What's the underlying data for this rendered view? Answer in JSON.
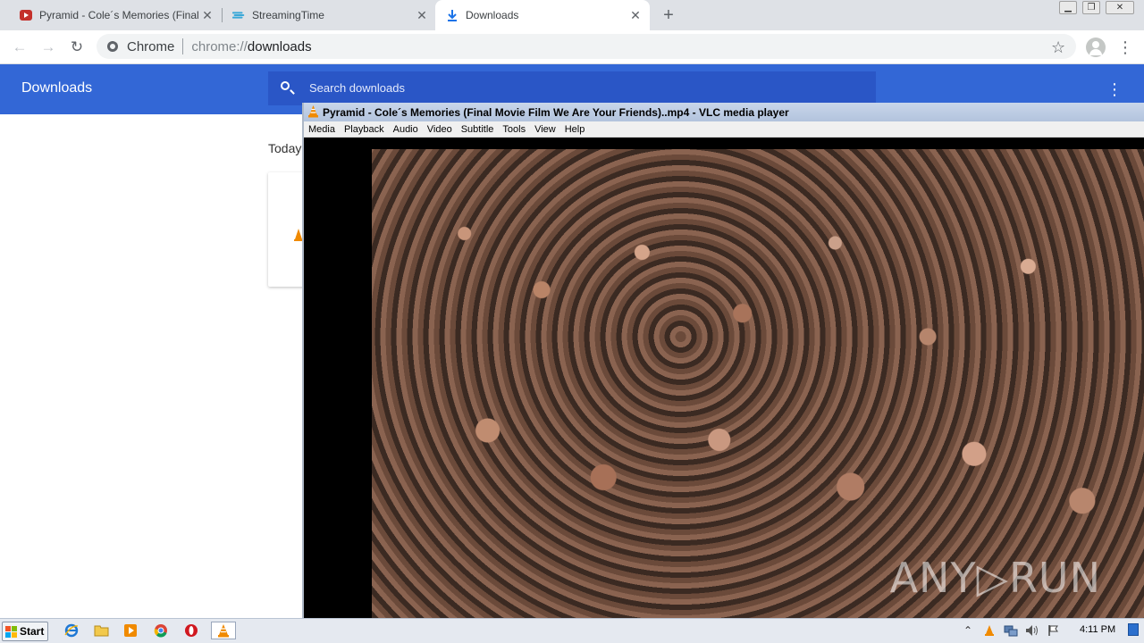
{
  "browser": {
    "tabs": [
      {
        "title": "Pyramid - Cole´s Memories (Final Mo",
        "favicon": "video-play-icon",
        "close": "✕",
        "active": false
      },
      {
        "title": "StreamingTime",
        "favicon": "streaming-icon",
        "close": "✕",
        "active": false
      },
      {
        "title": "Downloads",
        "favicon": "download-icon",
        "close": "✕",
        "active": true
      }
    ],
    "new_tab": "+",
    "window_buttons": {
      "minimize": "▁",
      "restore": "❐",
      "close": "✕"
    },
    "nav": {
      "back": "←",
      "forward": "→",
      "reload": "↻"
    },
    "omnibox": {
      "chip": "Chrome",
      "scheme": "chrome://",
      "host": "downloads"
    },
    "star": "☆",
    "menu": "⋮"
  },
  "downloads_page": {
    "title": "Downloads",
    "search_placeholder": "Search downloads",
    "menu": "⋮",
    "section": "Today"
  },
  "vlc": {
    "title": "Pyramid - Cole´s Memories (Final Movie Film We Are Your Friends)..mp4 - VLC media player",
    "menu": [
      "Media",
      "Playback",
      "Audio",
      "Video",
      "Subtitle",
      "Tools",
      "View",
      "Help"
    ],
    "watermark": "ANY▷RUN"
  },
  "taskbar": {
    "start": "Start",
    "pinned": [
      "ie-icon",
      "explorer-folder-icon",
      "media-player-icon",
      "chrome-icon",
      "opera-icon",
      "vlc-icon"
    ],
    "tray": [
      "show-hidden-icons",
      "vlc-tray-icon",
      "network-icon",
      "volume-icon",
      "action-center-flag-icon"
    ],
    "tray_expand": "⌃",
    "clock": "4:11 PM"
  },
  "colors": {
    "downloads_header": "#3367d6",
    "search_box": "#2a56c6",
    "tab_strip": "#dee1e6",
    "vlc_cone": "#f08a00"
  }
}
